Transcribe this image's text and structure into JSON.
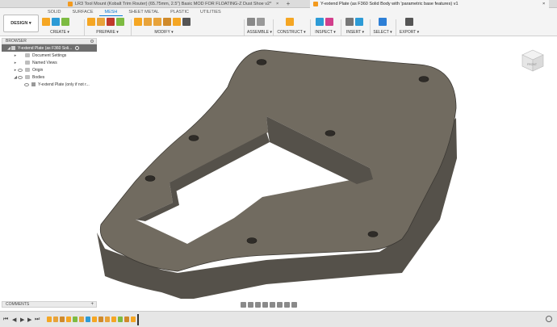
{
  "window": {
    "tabs": [
      {
        "title": "LR3 Tool Mount (Kobalt Trim Router) (65.75mm, 2.5\") Basic MOD FOR FLOATING-Z Dust Shoe v2*",
        "active": false,
        "icon_color": "#f39a1e"
      },
      {
        "title": "Y-extend Plate (as F360 Solid Body with 'parametric base features) v1",
        "active": true,
        "icon_color": "#f39a1e"
      }
    ],
    "close_glyph": "×",
    "new_tab_glyph": "+"
  },
  "toolbar": {
    "workspace_label": "DESIGN ▾",
    "tabs": [
      {
        "label": "SOLID",
        "active": false
      },
      {
        "label": "SURFACE",
        "active": false
      },
      {
        "label": "MESH",
        "active": true
      },
      {
        "label": "SHEET METAL",
        "active": false
      },
      {
        "label": "PLASTIC",
        "active": false
      },
      {
        "label": "UTILITIES",
        "active": false
      }
    ],
    "groups": [
      {
        "label": "CREATE ▾",
        "icons": [
          "#f5a623",
          "#2d9bd6",
          "#7dbb42"
        ]
      },
      {
        "label": "PREPARE ▾",
        "icons": [
          "#f5a623",
          "#e8a33a",
          "#c0392b",
          "#7dbb42"
        ]
      },
      {
        "label": "MODIFY ▾",
        "icons": [
          "#f5a623",
          "#e8a33a",
          "#e8a33a",
          "#d08a2a",
          "#f5a623",
          "#555555"
        ]
      },
      {
        "label": "ASSEMBLE ▾",
        "icons": [
          "#888888",
          "#999999"
        ]
      },
      {
        "label": "CONSTRUCT ▾",
        "icons": [
          "#f5a623"
        ]
      },
      {
        "label": "INSPECT ▾",
        "icons": [
          "#2d9bd6",
          "#d23f8c"
        ]
      },
      {
        "label": "INSERT ▾",
        "icons": [
          "#777777",
          "#2d9bd6"
        ]
      },
      {
        "label": "SELECT ▾",
        "icons": [
          "#2d7fd6"
        ]
      },
      {
        "label": "EXPORT ▾",
        "icons": [
          "#555555"
        ]
      }
    ]
  },
  "browser": {
    "title": "BROWSER",
    "items": [
      {
        "label": "Y-extend Plate (as F360 Soli...",
        "kind": "root",
        "caret": "◢"
      },
      {
        "label": "Document Settings",
        "kind": "folder",
        "caret": "▸"
      },
      {
        "label": "Named Views",
        "kind": "folder",
        "caret": "▸"
      },
      {
        "label": "Origin",
        "kind": "folder",
        "caret": "▸"
      },
      {
        "label": "Bodies",
        "kind": "folder",
        "caret": "◢"
      },
      {
        "label": "Y-extend Plate (only if not r...",
        "kind": "body",
        "caret": ""
      }
    ]
  },
  "comments": {
    "title": "COMMENTS",
    "add_glyph": "+"
  },
  "timeline": {
    "controls": [
      "⏮",
      "◀",
      "▶",
      "▶",
      "⏭"
    ],
    "item_colors": [
      "#f5a623",
      "#e8a33a",
      "#d08a2a",
      "#f5a623",
      "#7dbb42",
      "#e8a33a",
      "#2d9bd6",
      "#f5a623",
      "#d08a2a",
      "#e8a33a",
      "#f5a623",
      "#7dbb42",
      "#d08a2a",
      "#f5a623"
    ]
  },
  "viewcube": {
    "label": "FRONT"
  },
  "colors": {
    "plate_top": "#716b60",
    "plate_side": "#55514a",
    "plate_edge": "#3b3833",
    "accent": "#0a7bd6"
  }
}
